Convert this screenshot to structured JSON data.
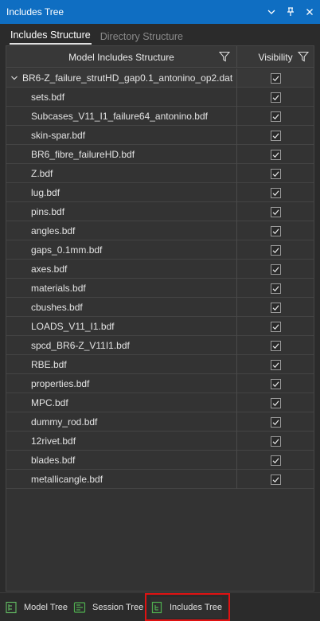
{
  "panel": {
    "title": "Includes Tree",
    "buttons": [
      "chevron-down-icon",
      "pin-icon",
      "close-icon"
    ]
  },
  "tabs": [
    {
      "label": "Includes Structure",
      "active": true
    },
    {
      "label": "Directory Structure",
      "active": false
    }
  ],
  "grid": {
    "columns": {
      "structure": "Model Includes Structure",
      "visibility": "Visibility"
    },
    "root": {
      "label": "BR6-Z_failure_strutHD_gap0.1_antonino_op2.dat",
      "expanded": true,
      "visible": true
    },
    "children": [
      {
        "label": "sets.bdf",
        "visible": true
      },
      {
        "label": "Subcases_V11_I1_failure64_antonino.bdf",
        "visible": true
      },
      {
        "label": "skin-spar.bdf",
        "visible": true
      },
      {
        "label": "BR6_fibre_failureHD.bdf",
        "visible": true
      },
      {
        "label": "Z.bdf",
        "visible": true
      },
      {
        "label": "lug.bdf",
        "visible": true
      },
      {
        "label": "pins.bdf",
        "visible": true
      },
      {
        "label": "angles.bdf",
        "visible": true
      },
      {
        "label": "gaps_0.1mm.bdf",
        "visible": true
      },
      {
        "label": "axes.bdf",
        "visible": true
      },
      {
        "label": "materials.bdf",
        "visible": true
      },
      {
        "label": "cbushes.bdf",
        "visible": true
      },
      {
        "label": "LOADS_V11_I1.bdf",
        "visible": true
      },
      {
        "label": "spcd_BR6-Z_V11I1.bdf",
        "visible": true
      },
      {
        "label": "RBE.bdf",
        "visible": true
      },
      {
        "label": "properties.bdf",
        "visible": true
      },
      {
        "label": "MPC.bdf",
        "visible": true
      },
      {
        "label": "dummy_rod.bdf",
        "visible": true
      },
      {
        "label": "12rivet.bdf",
        "visible": true
      },
      {
        "label": "blades.bdf",
        "visible": true
      },
      {
        "label": "metallicangle.bdf",
        "visible": true
      }
    ]
  },
  "bottom_tabs": [
    {
      "label": "Model Tree",
      "icon": "model-tree-icon",
      "active": false
    },
    {
      "label": "Session Tree",
      "icon": "session-tree-icon",
      "active": false
    },
    {
      "label": "Includes Tree",
      "icon": "includes-tree-icon",
      "active": true
    }
  ],
  "colors": {
    "titlebar": "#0f6ec2",
    "background": "#2b2b2b",
    "grid": "#333333",
    "highlight": "#e01212"
  }
}
